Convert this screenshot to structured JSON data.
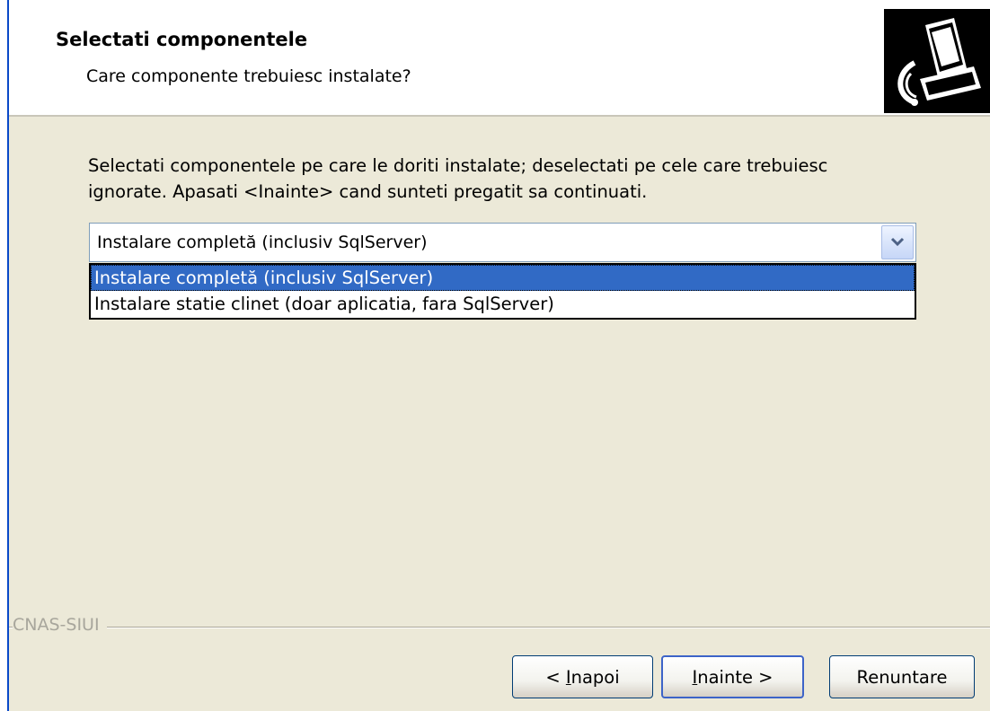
{
  "header": {
    "title": "Selectati componentele",
    "subtitle": "Care componente trebuiesc instalate?"
  },
  "instructions": {
    "line1": "Selectati componentele pe care le doriti instalate; deselectati pe cele care trebuiesc",
    "line2": "ignorate. Apasati <Inainte> cand sunteti pregatit sa continuati."
  },
  "combo": {
    "selected": "Instalare completă (inclusiv SqlServer)",
    "options": [
      "Instalare completă (inclusiv SqlServer)",
      "Instalare statie clinet (doar aplicatia, fara SqlServer)"
    ]
  },
  "brand": "CNAS-SIUI",
  "buttons": {
    "back_prefix": "< ",
    "back_accel": "I",
    "back_rest": "napoi",
    "next_accel": "I",
    "next_rest": "nainte >",
    "cancel": "Renuntare"
  },
  "icons": {
    "header_icon": "setup-computer-icon",
    "combo_arrow": "chevron-down-icon"
  }
}
